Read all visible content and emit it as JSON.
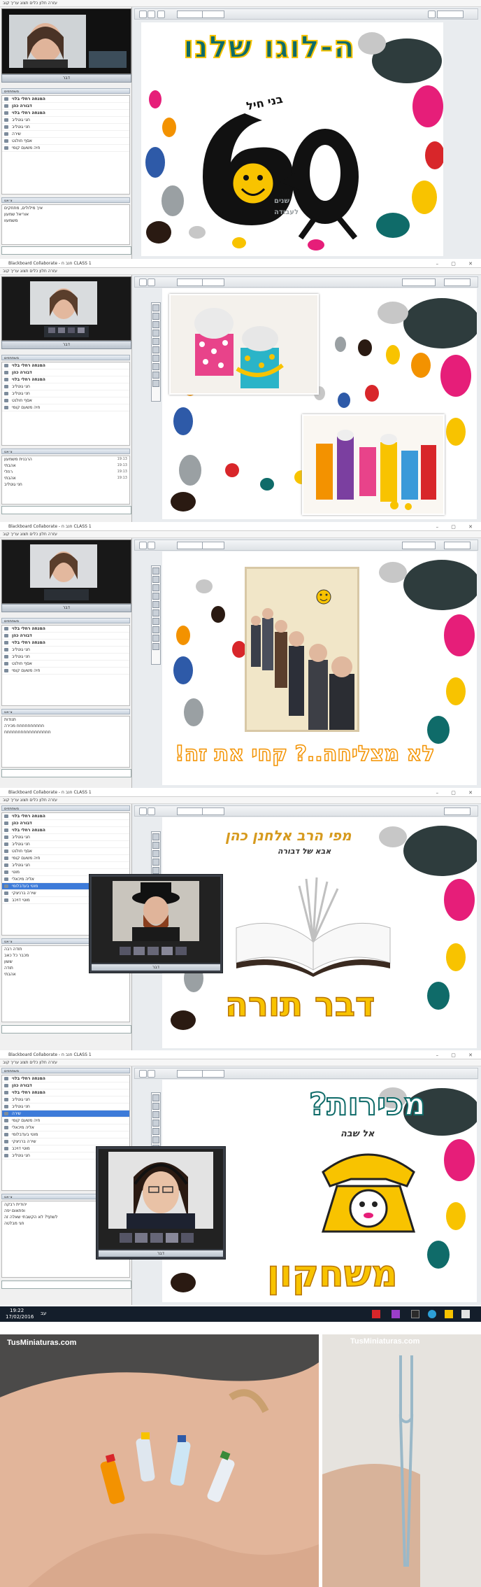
{
  "colors": {
    "pink": "#e61e79",
    "yellow": "#f8c300",
    "teal": "#0f6b69",
    "red": "#d8262a",
    "orange": "#f39200",
    "brown": "#2a1a12",
    "grey": "#9aa0a3",
    "lightgrey": "#c7c7c7",
    "blue": "#2e5aa8"
  },
  "screens": [
    {
      "window_title": "",
      "menu": "עזרה חלון כלים תצוג עריך קוב",
      "video_label": "דבר",
      "participant_header": "משתתפים",
      "participants": [
        "המנחה רחלי בלוי",
        "דבורה כהן",
        "המנחה רחלי בלוי",
        "חגי גוטליב",
        "חני גוטליב",
        "שירה",
        "אסף חולנט",
        "חיה משעם קומי"
      ],
      "chat_header": "צ׳אט",
      "chat_lines": [
        {
          "text": "איך מילולים, מתחקים",
          "time": ""
        },
        {
          "text": "",
          "time": "19:11"
        },
        {
          "text": "",
          "time": "19:11"
        },
        {
          "text": "אוריאל שמעון",
          "time": ""
        },
        {
          "text": "",
          "time": "19:12"
        },
        {
          "text": "משמעוו",
          "time": ""
        }
      ],
      "slide": {
        "title": "ה-לוגו שלנו",
        "sub1": "בני חיל",
        "big": "60",
        "line1": "שנים",
        "line2": "לעבודה"
      }
    },
    {
      "window_title": "Blackboard Collaborate - חנב ח CLASS 1",
      "menu": "עזרה חלון כלים תצוג עריך קוב",
      "video_label": "דבר",
      "participant_header": "משתתפים",
      "participants": [
        "המנחה רחלי בלוי",
        "דבורה כהן",
        "המנחה רחלי בלוי",
        "חגי גוטליב",
        "חני גוטליב",
        "אסף חולנט",
        "חיה משעם קומי"
      ],
      "chat_header": "צ׳אט",
      "chat_lines": [
        {
          "text": "הרבנית משמעון",
          "time": "19:13"
        },
        {
          "text": "אהבתי",
          "time": "19:13"
        },
        {
          "text": "רחלי",
          "time": "19:13"
        },
        {
          "text": "אהבתי",
          "time": "19:13"
        },
        {
          "text": "חני גוטליב",
          "time": ""
        }
      ],
      "slide": {}
    },
    {
      "window_title": "Blackboard Collaborate - חנב ח CLASS 1",
      "menu": "עזרה חלון כלים תצוג עריך קוב",
      "video_label": "דבר",
      "participant_header": "משתתפים",
      "participants": [
        "המנחה רחלי בלוי",
        "דבורה כהן",
        "המנחה רחלי בלוי",
        "חגי גוטליב",
        "חני גוטליב",
        "אסף חולנט",
        "חיה משעם קומי"
      ],
      "chat_header": "צ׳אט",
      "chat_lines": [
        {
          "text": "תנודות",
          "time": ""
        },
        {
          "text": "",
          "time": "19:13"
        },
        {
          "text": "חחחחחחחחחח מכירה",
          "time": ""
        },
        {
          "text": "",
          "time": "19:13"
        },
        {
          "text": "חחחחחחחחחחחחחחחחח",
          "time": ""
        }
      ],
      "slide": {
        "caption": "לא מצליחה..? קחי את זה!"
      }
    },
    {
      "window_title": "Blackboard Collaborate - חנב ח CLASS 1",
      "menu": "עזרה חלון כלים תצוג עריך קוב",
      "video_label": "דבר",
      "participant_header": "משתתפים",
      "participants": [
        "המנחה רחלי בלוי",
        "דבורה כהן",
        "המנחה רחלי בלוי",
        "חגי גוטליב",
        "חני גוטליב",
        "אסף חולנט",
        "חיה משעם קומי",
        "חגי גוטליב",
        "מוטי",
        "אליה מיכאלי",
        "מוטי בעדבלומי",
        "שירה ברניצקי",
        "מוטי דויכב"
      ],
      "chat_header": "צ׳אט",
      "chat_lines": [
        {
          "text": "תודה רבה",
          "time": "19:18"
        },
        {
          "text": "מכבר כל כאב",
          "time": "19:18"
        },
        {
          "text": "ששון",
          "time": "19:19"
        },
        {
          "text": "תודה",
          "time": "19:19"
        },
        {
          "text": "אהבתי",
          "time": ""
        }
      ],
      "slide": {
        "top": "מפי הרב אלחנן כהן",
        "sub": "אבא של דבורה",
        "title": "דבר תורה"
      }
    },
    {
      "window_title": "Blackboard Collaborate - חנב ח CLASS 1",
      "menu": "עזרה חלון כלים תצוג עריך קוב",
      "video_label": "דבר",
      "participant_header": "משתתפים",
      "participants": [
        "המנחה רחלי בלוי",
        "דבורה כהן",
        "המנחה רחלי בלוי",
        "חגי גוטליב",
        "חני גוטליב",
        "שירה",
        "חיה משעם קומי",
        "אליה מיכאלי",
        "מוטי בעדבלומי",
        "שירה ברניצקי",
        "מוטי דויכב",
        "חגי גוטליב"
      ],
      "chat_header": "צ׳אט",
      "chat_lines": [
        {
          "text": "יהודית רבקה",
          "time": ""
        },
        {
          "text": "ופתאום יפה",
          "time": ""
        },
        {
          "text": "לשתף? לא הקשבתי שאלה זה",
          "time": ""
        },
        {
          "text": "",
          "time": "19:23"
        },
        {
          "text": "חגי מבלטה",
          "time": ""
        }
      ],
      "slide": {
        "title": "מכירות?",
        "sub": "אל שבה",
        "bottom": "משחקון"
      }
    }
  ],
  "taskbar": {
    "time": "19:22",
    "date": "17/02/2016",
    "lang": "עב"
  },
  "photos": [
    {
      "brand": "TusMiniaturas.com"
    },
    {
      "brand": "TusMiniaturas.com"
    }
  ]
}
